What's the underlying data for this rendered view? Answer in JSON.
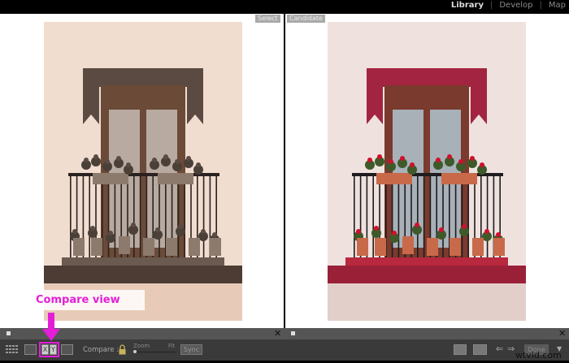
{
  "modules": {
    "items": [
      "Library",
      "Develop",
      "Map"
    ],
    "active": "Library"
  },
  "compare": {
    "select_label": "Select",
    "candidate_label": "Candidate"
  },
  "toolbar": {
    "compare_label": "Compare :",
    "zoom_label": "Zoom",
    "fit_label": "Fit",
    "sync_label": "Sync",
    "done_label": "Done",
    "xy_x": "X",
    "xy_y": "Y",
    "zoom_level": 0
  },
  "annotation": {
    "text": "Compare view",
    "color": "#e41ed8"
  },
  "watermark": "wtvid.com",
  "photos": {
    "select_palette": "sepia",
    "candidate_palette": "color"
  }
}
